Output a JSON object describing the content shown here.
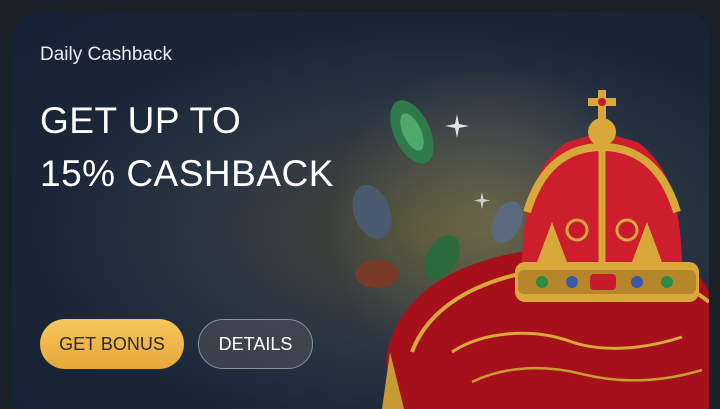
{
  "promo": {
    "subtitle": "Daily Cashback",
    "headline_line1": "GET UP TO",
    "headline_line2": "15% CASHBACK",
    "primary_button": "GET BONUS",
    "secondary_button": "DETAILS"
  },
  "colors": {
    "primary_button_bg": "#f0b84a",
    "secondary_button_border": "#8d929b",
    "background_dark": "#142033",
    "cushion_red": "#b8121c",
    "gold": "#d8a93a"
  },
  "icons": [
    "crown-icon",
    "cushion-icon",
    "gem-icon",
    "sparkle-icon"
  ]
}
